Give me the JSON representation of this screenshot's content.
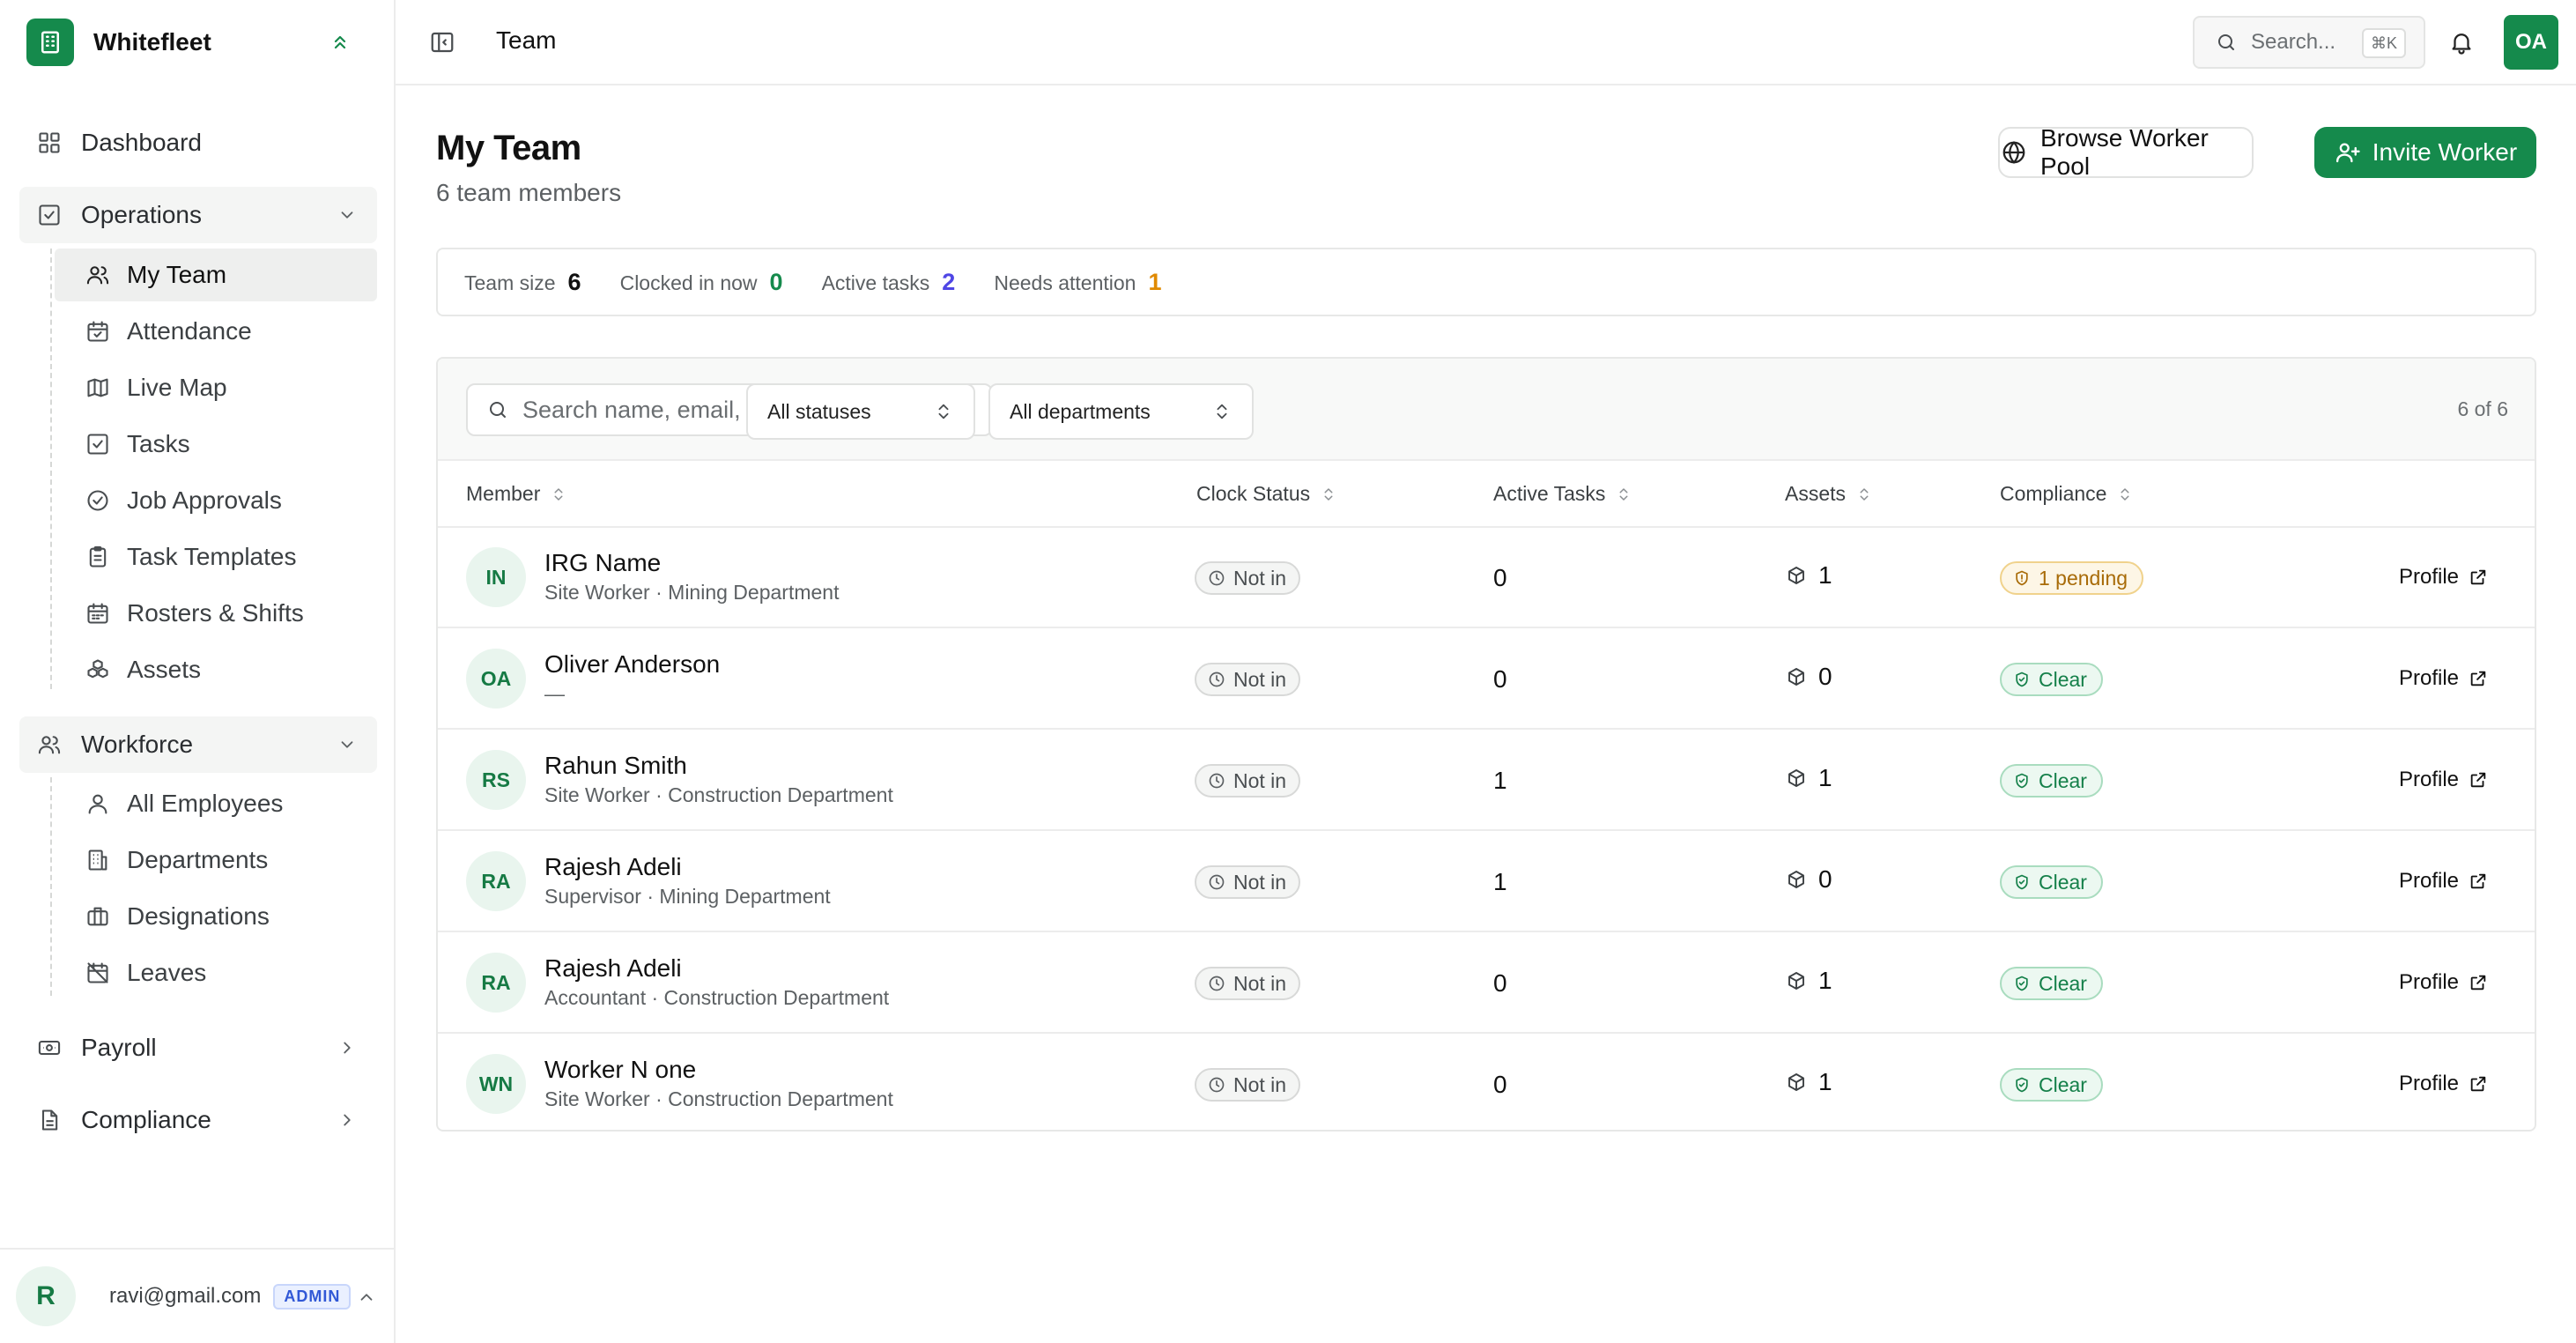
{
  "brand": {
    "name": "Whitefleet"
  },
  "sidebar": {
    "dashboard": "Dashboard",
    "operations": {
      "label": "Operations",
      "items": [
        {
          "label": "My Team",
          "icon": "users-icon"
        },
        {
          "label": "Attendance",
          "icon": "calendar-check-icon"
        },
        {
          "label": "Live Map",
          "icon": "map-icon"
        },
        {
          "label": "Tasks",
          "icon": "checkbox-icon"
        },
        {
          "label": "Job Approvals",
          "icon": "circle-check-icon"
        },
        {
          "label": "Task Templates",
          "icon": "clipboard-icon"
        },
        {
          "label": "Rosters & Shifts",
          "icon": "calendar-icon"
        },
        {
          "label": "Assets",
          "icon": "boxes-icon"
        }
      ]
    },
    "workforce": {
      "label": "Workforce",
      "items": [
        {
          "label": "All Employees",
          "icon": "user-icon"
        },
        {
          "label": "Departments",
          "icon": "building-icon"
        },
        {
          "label": "Designations",
          "icon": "briefcase-icon"
        },
        {
          "label": "Leaves",
          "icon": "calendar-off-icon"
        }
      ]
    },
    "payroll": "Payroll",
    "compliance": "Compliance",
    "user": {
      "initial": "R",
      "email": "ravi@gmail.com",
      "role": "ADMIN"
    }
  },
  "topbar": {
    "title": "Team",
    "search_placeholder": "Search...",
    "shortcut": "⌘K",
    "avatar": "OA"
  },
  "page": {
    "title": "My Team",
    "subtitle": "6 team members",
    "browse_label": "Browse Worker Pool",
    "invite_label": "Invite Worker"
  },
  "stats": [
    {
      "label": "Team size",
      "value": "6",
      "color": "#111111"
    },
    {
      "label": "Clocked in now",
      "value": "0",
      "color": "#158a4c"
    },
    {
      "label": "Active tasks",
      "value": "2",
      "color": "#4f46e5"
    },
    {
      "label": "Needs attention",
      "value": "1",
      "color": "#e08a00"
    }
  ],
  "filters": {
    "search_placeholder": "Search name, email, designation...",
    "status": "All statuses",
    "department": "All departments",
    "count": "6 of 6"
  },
  "table": {
    "headers": {
      "member": "Member",
      "clock": "Clock Status",
      "tasks": "Active Tasks",
      "assets": "Assets",
      "compliance": "Compliance"
    },
    "profile_label": "Profile",
    "rows": [
      {
        "initials": "IN",
        "name": "IRG Name",
        "sub": "Site Worker · Mining Department",
        "clock": "Not in",
        "tasks": "0",
        "assets": "1",
        "compliance": "1 pending",
        "compliance_state": "pending"
      },
      {
        "initials": "OA",
        "name": "Oliver Anderson",
        "sub": "—",
        "clock": "Not in",
        "tasks": "0",
        "assets": "0",
        "compliance": "Clear",
        "compliance_state": "clear"
      },
      {
        "initials": "RS",
        "name": "Rahun Smith",
        "sub": "Site Worker · Construction Department",
        "clock": "Not in",
        "tasks": "1",
        "assets": "1",
        "compliance": "Clear",
        "compliance_state": "clear"
      },
      {
        "initials": "RA",
        "name": "Rajesh Adeli",
        "sub": "Supervisor · Mining Department",
        "clock": "Not in",
        "tasks": "1",
        "assets": "0",
        "compliance": "Clear",
        "compliance_state": "clear"
      },
      {
        "initials": "RA",
        "name": "Rajesh Adeli",
        "sub": "Accountant · Construction Department",
        "clock": "Not in",
        "tasks": "0",
        "assets": "1",
        "compliance": "Clear",
        "compliance_state": "clear"
      },
      {
        "initials": "WN",
        "name": "Worker N one",
        "sub": "Site Worker · Construction Department",
        "clock": "Not in",
        "tasks": "0",
        "assets": "1",
        "compliance": "Clear",
        "compliance_state": "clear"
      }
    ]
  },
  "colors": {
    "accent": "#158a4c",
    "clear": "#15804a",
    "pending": "#a86b08"
  }
}
